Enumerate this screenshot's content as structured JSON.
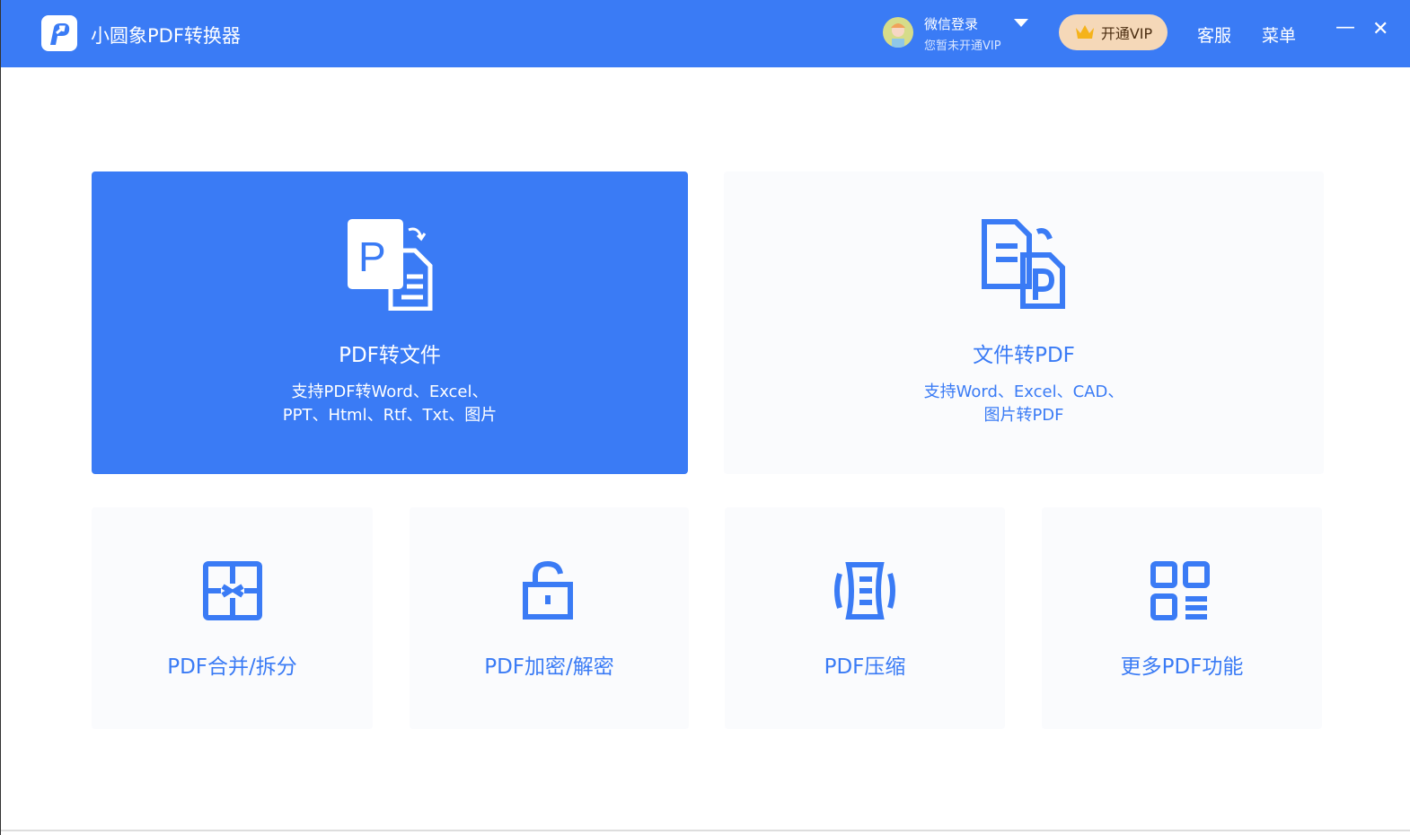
{
  "header": {
    "app_title": "小圆象PDF转换器",
    "login_label": "微信登录",
    "vip_status": "您暂未开通VIP",
    "vip_button": "开通VIP",
    "service": "客服",
    "menu": "菜单",
    "minimize": "—",
    "close": "✕"
  },
  "cards": {
    "pdf_to_file": {
      "title": "PDF转文件",
      "desc1": "支持PDF转Word、Excel、",
      "desc2": "PPT、Html、Rtf、Txt、图片"
    },
    "file_to_pdf": {
      "title": "文件转PDF",
      "desc1": "支持Word、Excel、CAD、",
      "desc2": "图片转PDF"
    },
    "merge_split": {
      "title": "PDF合并/拆分"
    },
    "encrypt": {
      "title": "PDF加密/解密"
    },
    "compress": {
      "title": "PDF压缩"
    },
    "more": {
      "title": "更多PDF功能"
    }
  },
  "colors": {
    "brand": "#3a7bf5",
    "vip_bg": "#f5d8b8"
  }
}
